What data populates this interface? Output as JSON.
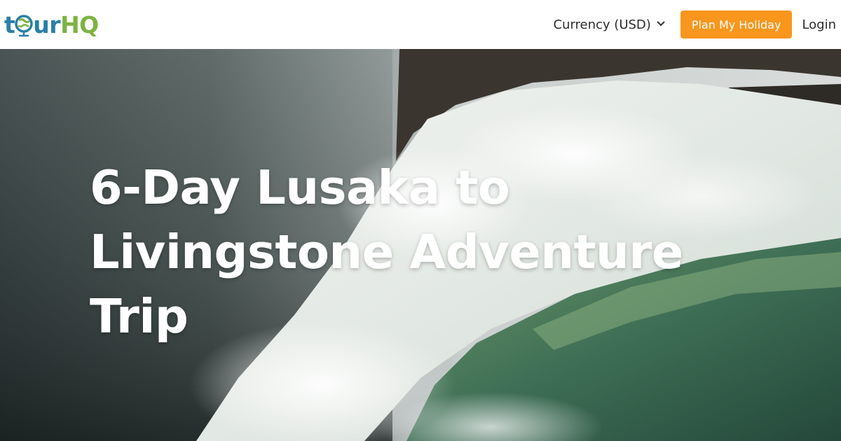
{
  "brand": {
    "logo_text_start": "t",
    "logo_text_mid": "ur",
    "logo_text_end": "HQ",
    "colors": {
      "blue": "#2b7fa8",
      "green": "#7cb342"
    }
  },
  "nav": {
    "currency_label": "Currency (USD)",
    "currency_icon": "chevron-down-icon",
    "plan_button": "Plan My Holiday",
    "login": "Login",
    "accent_color": "#f8961d"
  },
  "hero": {
    "title_line1": "6-Day Lusaka to",
    "title_line2": "Livingstone Adventure Trip",
    "image_subject": "waterfall"
  }
}
